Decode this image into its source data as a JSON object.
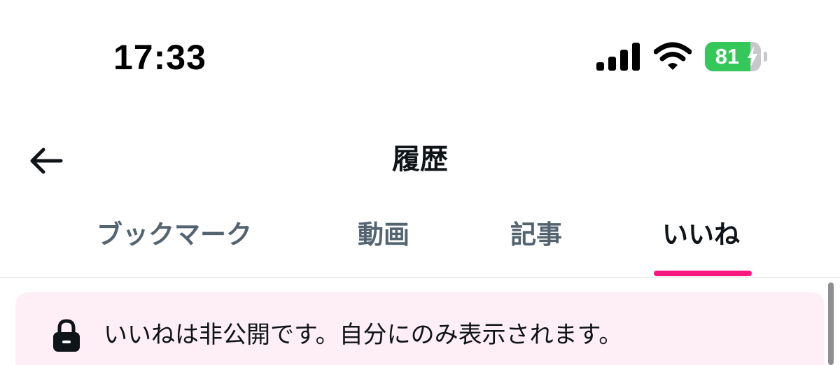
{
  "status_bar": {
    "time": "17:33",
    "battery_percent": "81",
    "battery_level": 0.81,
    "battery_charging": true,
    "icons": [
      "signal-icon",
      "wifi-icon",
      "battery-icon",
      "bolt-icon"
    ]
  },
  "header": {
    "title": "履歴",
    "back_icon": "back-arrow-icon"
  },
  "tabs": [
    {
      "label": "ブックマーク",
      "active": false
    },
    {
      "label": "動画",
      "active": false
    },
    {
      "label": "記事",
      "active": false
    },
    {
      "label": "いいね",
      "active": true
    }
  ],
  "notice": {
    "icon": "lock-icon",
    "text": "いいねは非公開です。自分にのみ表示されます。"
  },
  "colors": {
    "accent": "#f91880",
    "notice_background": "#fdeff5",
    "inactive_tab": "#536471",
    "active_tab": "#0f1419",
    "battery_green": "#34c759"
  }
}
